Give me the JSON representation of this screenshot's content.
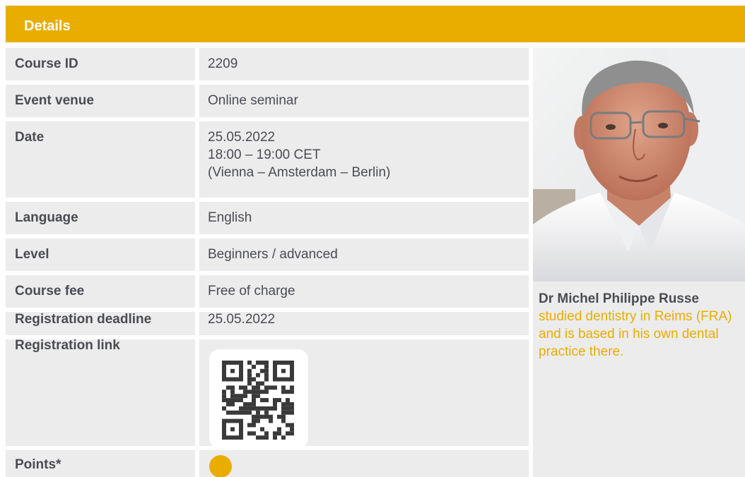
{
  "header": {
    "title": "Details"
  },
  "rows": [
    {
      "label": "Course ID",
      "value": "2209"
    },
    {
      "label": "Event venue",
      "value": "Online seminar"
    },
    {
      "label": "Date",
      "value_lines": [
        "25.05.2022",
        "18:00 – 19:00 CET",
        "(Vienna – Amsterdam – Berlin)"
      ]
    },
    {
      "label": "Language",
      "value": "English"
    },
    {
      "label": "Level",
      "value": "Beginners / advanced"
    },
    {
      "label": "Course fee",
      "value": "Free of charge"
    },
    {
      "label": "Registration deadline",
      "value": "25.05.2022"
    },
    {
      "label": "Registration link"
    },
    {
      "label": "Points*"
    }
  ],
  "speaker": {
    "name": "Dr Michel Philippe Russe",
    "bio": "studied dentistry in Reims (FRA) and is based in his own dental practice there."
  },
  "colors": {
    "accent": "#e9ad00",
    "row_bg": "#ececec",
    "text": "#4a4c53"
  }
}
